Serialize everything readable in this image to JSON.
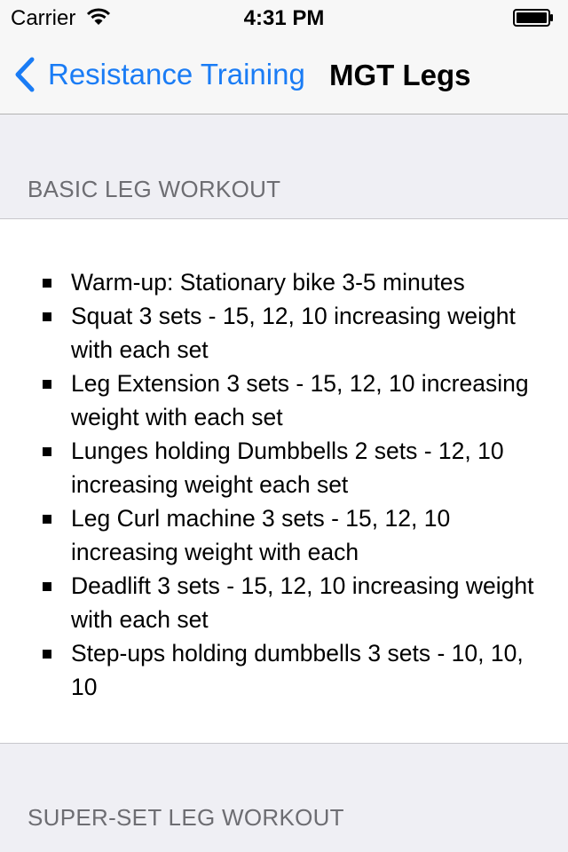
{
  "status_bar": {
    "carrier": "Carrier",
    "time": "4:31 PM"
  },
  "nav": {
    "back_label": "Resistance Training",
    "title": "MGT Legs"
  },
  "sections": [
    {
      "header": "BASIC LEG WORKOUT",
      "items": [
        "Warm-up: Stationary bike 3-5 minutes",
        "Squat 3 sets - 15, 12, 10 increasing weight with each set",
        "Leg Extension 3 sets - 15, 12, 10 increasing weight with each set",
        "Lunges holding Dumbbells 2 sets - 12, 10 increasing weight each set",
        "Leg Curl machine 3 sets - 15, 12, 10 increasing weight with each",
        "Deadlift 3 sets - 15, 12, 10 increasing weight with each set",
        "Step-ups holding dumbbells 3 sets - 10, 10, 10"
      ]
    },
    {
      "header": "SUPER-SET LEG WORKOUT"
    }
  ],
  "colors": {
    "accent": "#1a7cf5",
    "background": "#efeff4",
    "header_text": "#6d6d72"
  }
}
